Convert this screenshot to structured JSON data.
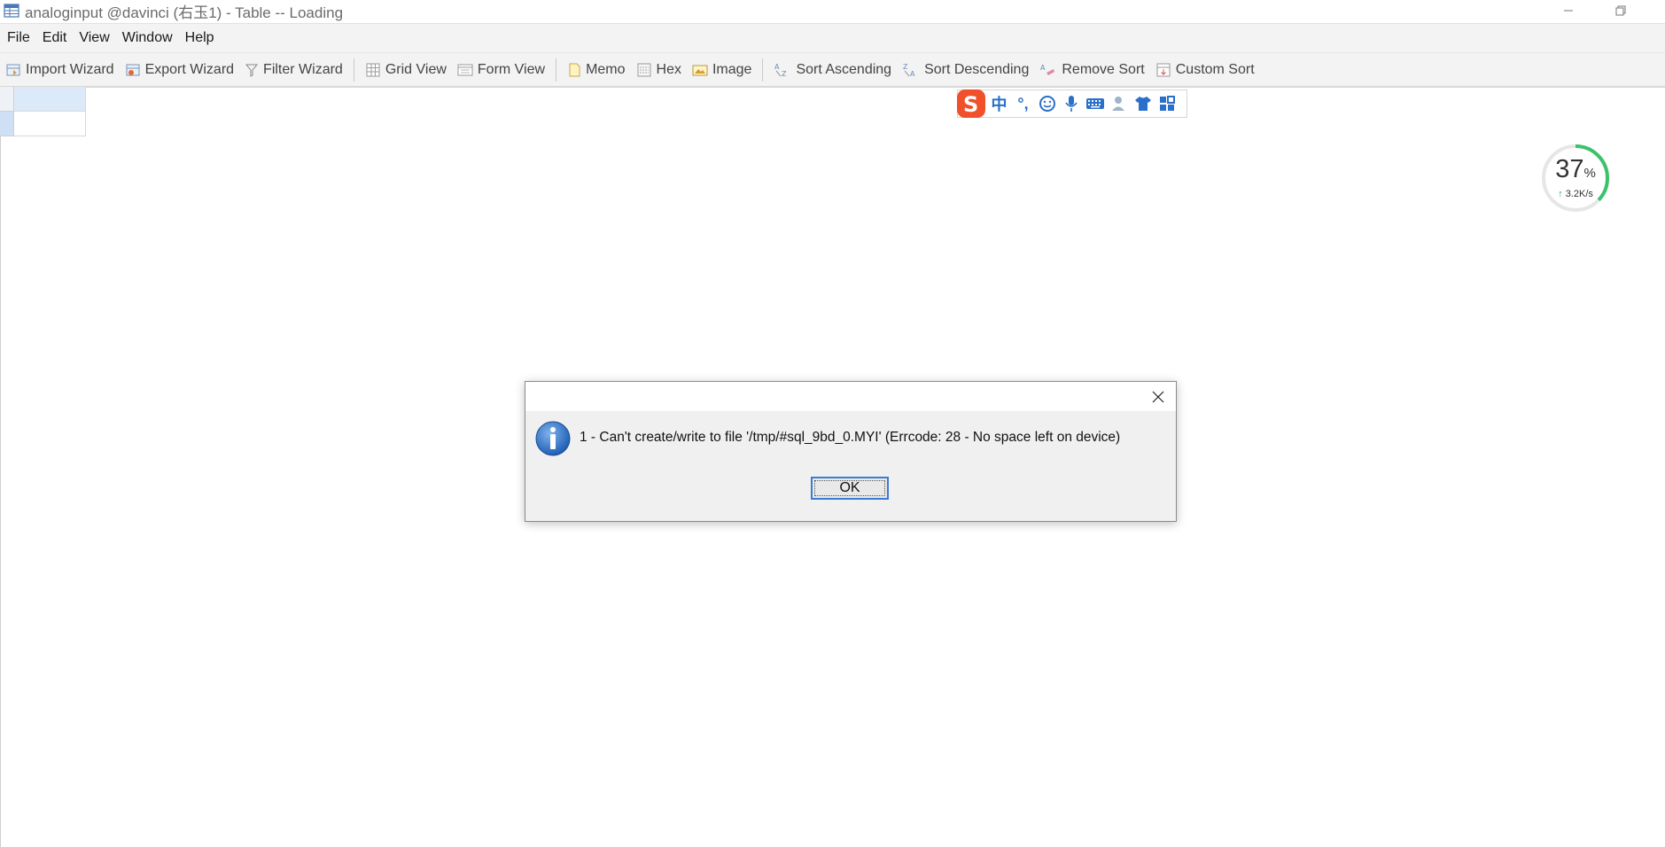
{
  "window": {
    "title": "analoginput @davinci (右玉1) - Table -- Loading",
    "minimize_icon": "minimize-icon",
    "restore_icon": "restore-icon"
  },
  "menu": {
    "items": [
      "File",
      "Edit",
      "View",
      "Window",
      "Help"
    ]
  },
  "toolbar": {
    "buttons": [
      {
        "label": "Import Wizard",
        "icon": "import-wizard-icon"
      },
      {
        "label": "Export Wizard",
        "icon": "export-wizard-icon"
      },
      {
        "label": "Filter Wizard",
        "icon": "filter-icon"
      },
      {
        "label": "Grid View",
        "icon": "grid-view-icon"
      },
      {
        "label": "Form View",
        "icon": "form-view-icon"
      },
      {
        "label": "Memo",
        "icon": "memo-icon"
      },
      {
        "label": "Hex",
        "icon": "hex-icon"
      },
      {
        "label": "Image",
        "icon": "image-icon"
      },
      {
        "label": "Sort Ascending",
        "icon": "sort-ascending-icon"
      },
      {
        "label": "Sort Descending",
        "icon": "sort-descending-icon"
      },
      {
        "label": "Remove Sort",
        "icon": "remove-sort-icon"
      },
      {
        "label": "Custom Sort",
        "icon": "custom-sort-icon"
      }
    ]
  },
  "ime": {
    "items": [
      "中",
      "°,"
    ],
    "icons": [
      "sogou-logo-icon",
      "emoji-icon",
      "microphone-icon",
      "keyboard-icon",
      "user-icon",
      "skin-shirt-icon",
      "toolbox-grid-icon"
    ]
  },
  "speed_widget": {
    "percent": "37",
    "percent_sign": "%",
    "arrow": "↑",
    "rate": "3.2K/s",
    "level": 0.37,
    "accent": "#3cc26a"
  },
  "dialog": {
    "message": "1 - Can't create/write to file '/tmp/#sql_9bd_0.MYI' (Errcode: 28 - No space left on device)",
    "ok_label": "OK",
    "icon": "info-icon",
    "close_icon": "close-icon"
  },
  "colors": {
    "selection": "#dce9f8",
    "accent_blue": "#3a7bd5",
    "ime_blue": "#2a6fc9",
    "sogou_orange": "#f0502a"
  }
}
